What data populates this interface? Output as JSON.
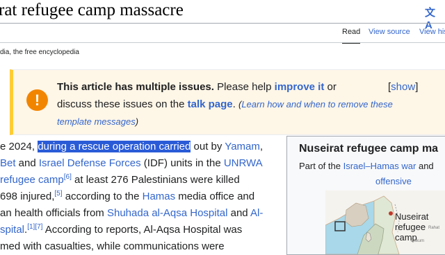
{
  "header": {
    "title": "rat refugee camp massacre",
    "language_icon": "translate-icon",
    "language_glyph": "文A"
  },
  "tabs": {
    "read": "Read",
    "view_source": "View source",
    "view_history": "View his"
  },
  "tagline": "dia, the free encyclopedia",
  "notice": {
    "icon": "exclamation-icon",
    "bold": "This article has multiple issues.",
    "text1": " Please help ",
    "improve_link": "improve it",
    "text2": " or",
    "text3": "discuss these issues on the ",
    "talk_link": "talk page",
    "text4": ". ",
    "small_open": "(",
    "small_link": "Learn how and when to remove these",
    "small_line2": "template messages",
    "small_close": ")",
    "show_open": "[",
    "show_link": "show",
    "show_close": "]"
  },
  "body": {
    "l1_a": "e 2024, ",
    "l1_hl": "during a rescue operation carried",
    "l1_b": " out by ",
    "l1_link": "Yamam",
    "l1_c": ",",
    "l2_link1": "Bet",
    "l2_a": " and ",
    "l2_link2": "Israel Defense Forces",
    "l2_b": " (IDF) units in the ",
    "l2_link3": "UNRWA",
    "l3_link": "refugee camp",
    "l3_ref": "[6]",
    "l3_a": " at least 276 Palestinians were killed",
    "l4_a": "698 injured,",
    "l4_ref": "[5]",
    "l4_b": " according to the ",
    "l4_link": "Hamas",
    "l4_c": " media office and",
    "l5_a": "an health officials from ",
    "l5_link1": "Shuhada al-Aqsa Hospital",
    "l5_b": " and ",
    "l5_link2": "Al-",
    "l6_link": "spital",
    "l6_a": ".",
    "l6_ref1": "[1]",
    "l6_ref2": "[7]",
    "l6_b": " According to reports, Al-Aqsa Hospital was",
    "l7_a": "med with casualties, while communications were"
  },
  "infobox": {
    "title": "Nuseirat refugee camp ma",
    "sub_a": "Part of the ",
    "sub_link1": "Israel–Hamas war",
    "sub_b": " and",
    "sub_link2": "offensive",
    "map_label_1": "Nuseirat",
    "map_label_2": "refugee",
    "map_label_3": "camp",
    "map_small_1": "Rahat",
    "map_small_2": "Dukum"
  },
  "colors": {
    "link": "#3366cc",
    "highlight": "#2a5bd7",
    "notice_bar": "#ffcc33",
    "notice_icon": "#f28500"
  }
}
